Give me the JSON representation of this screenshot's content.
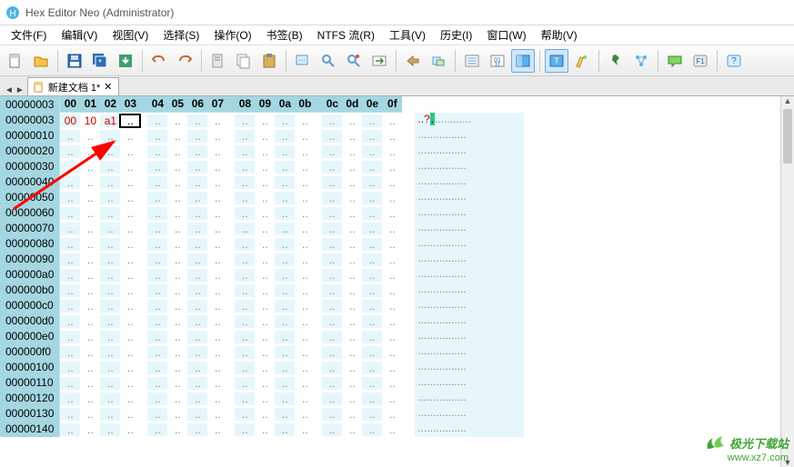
{
  "window": {
    "title": "Hex Editor Neo (Administrator)"
  },
  "menus": [
    "文件(F)",
    "编辑(V)",
    "视图(V)",
    "选择(S)",
    "操作(O)",
    "书签(B)",
    "NTFS 流(R)",
    "工具(V)",
    "历史(I)",
    "窗口(W)",
    "帮助(V)"
  ],
  "tab": {
    "label": "新建文档 1*"
  },
  "nav_arrows": [
    "◄",
    "►"
  ],
  "header_offset": "00000003",
  "col_headers": [
    "00",
    "01",
    "02",
    "03",
    "04",
    "05",
    "06",
    "07",
    "08",
    "09",
    "0a",
    "0b",
    "0c",
    "0d",
    "0e",
    "0f"
  ],
  "rows": [
    {
      "offset": "00000003",
      "bytes": [
        "00",
        "10",
        "a1",
        ".."
      ],
      "ascii": "..?",
      "cursor": 3
    },
    {
      "offset": "00000010"
    },
    {
      "offset": "00000020"
    },
    {
      "offset": "00000030"
    },
    {
      "offset": "00000040"
    },
    {
      "offset": "00000050"
    },
    {
      "offset": "00000060"
    },
    {
      "offset": "00000070"
    },
    {
      "offset": "00000080"
    },
    {
      "offset": "00000090"
    },
    {
      "offset": "000000a0"
    },
    {
      "offset": "000000b0"
    },
    {
      "offset": "000000c0"
    },
    {
      "offset": "000000d0"
    },
    {
      "offset": "000000e0"
    },
    {
      "offset": "000000f0"
    },
    {
      "offset": "00000100"
    },
    {
      "offset": "00000110"
    },
    {
      "offset": "00000120"
    },
    {
      "offset": "00000130"
    },
    {
      "offset": "00000140"
    }
  ],
  "watermark": {
    "line1": "极光下载站",
    "line2": "www.xz7.com"
  },
  "toolbar_icons": [
    "new",
    "open",
    "save",
    "save-all",
    "export",
    "undo",
    "redo",
    "cut",
    "copy",
    "paste",
    "find",
    "search",
    "replace",
    "goto",
    "nav-back",
    "nav-fwd",
    "bookmark",
    "binary",
    "layout",
    "panel",
    "highlight",
    "pin",
    "network",
    "chat",
    "help-f1",
    "about"
  ]
}
